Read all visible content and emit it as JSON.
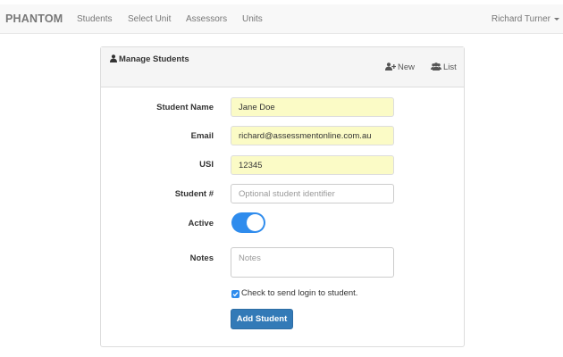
{
  "navbar": {
    "brand": "PHANTOM",
    "links": [
      "Students",
      "Select Unit",
      "Assessors",
      "Units"
    ],
    "user": "Richard Turner"
  },
  "panel": {
    "title": "Manage Students",
    "new_label": "New",
    "list_label": "List"
  },
  "form": {
    "student_name": {
      "label": "Student Name",
      "value": "Jane Doe"
    },
    "email": {
      "label": "Email",
      "value": "richard@assessmentonline.com.au"
    },
    "usi": {
      "label": "USI",
      "value": "12345"
    },
    "student_number": {
      "label": "Student #",
      "placeholder": "Optional student identifier"
    },
    "active": {
      "label": "Active"
    },
    "notes": {
      "label": "Notes",
      "placeholder": "Notes"
    },
    "send_login_label": "Check to send login to student.",
    "submit_label": "Add Student"
  },
  "colors": {
    "accent": "#2f8ced",
    "button": "#337ab7",
    "filled_field": "#fbfbc6"
  }
}
